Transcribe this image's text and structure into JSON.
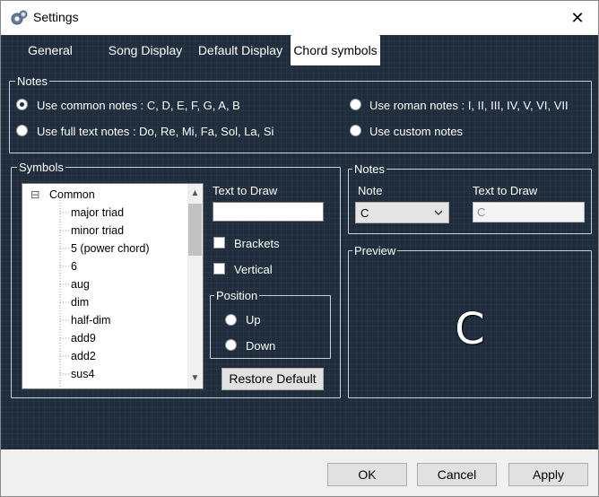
{
  "window": {
    "title": "Settings",
    "close_glyph": "✕",
    "icon": "gear-icon"
  },
  "tabs": [
    {
      "label": "General"
    },
    {
      "label": "Song Display"
    },
    {
      "label": "Default Display"
    },
    {
      "label": "Chord symbols",
      "active": true
    }
  ],
  "notes_group": {
    "legend": "Notes",
    "options": [
      {
        "label": "Use common notes : C, D, E, F, G, A, B",
        "checked": true
      },
      {
        "label": "Use full text notes : Do, Re, Mi, Fa, Sol, La, Si",
        "checked": false
      },
      {
        "label": "Use roman notes : I, II, III, IV, V, VI, VII",
        "checked": false
      },
      {
        "label": "Use custom notes",
        "checked": false
      }
    ]
  },
  "symbols_group": {
    "legend": "Symbols",
    "tree_root": "Common",
    "tree_toggle": "⊟",
    "items": [
      "major triad",
      "minor triad",
      "5 (power chord)",
      "6",
      "aug",
      "dim",
      "half-dim",
      "add9",
      "add2",
      "sus4"
    ],
    "text_to_draw_label": "Text to Draw",
    "text_to_draw_value": "",
    "brackets_label": "Brackets",
    "vertical_label": "Vertical",
    "position_legend": "Position",
    "position_up": "Up",
    "position_down": "Down",
    "restore_default": "Restore Default"
  },
  "notes_panel": {
    "legend": "Notes",
    "note_label": "Note",
    "note_value": "C",
    "text_to_draw_label": "Text to Draw",
    "text_to_draw_placeholder": "C"
  },
  "preview": {
    "legend": "Preview",
    "glyph": "C"
  },
  "footer": {
    "ok": "OK",
    "cancel": "Cancel",
    "apply": "Apply"
  },
  "colors": {
    "panel_bg": "#1f2d3c",
    "text": "#ffffff",
    "border": "#c8d0d8"
  }
}
